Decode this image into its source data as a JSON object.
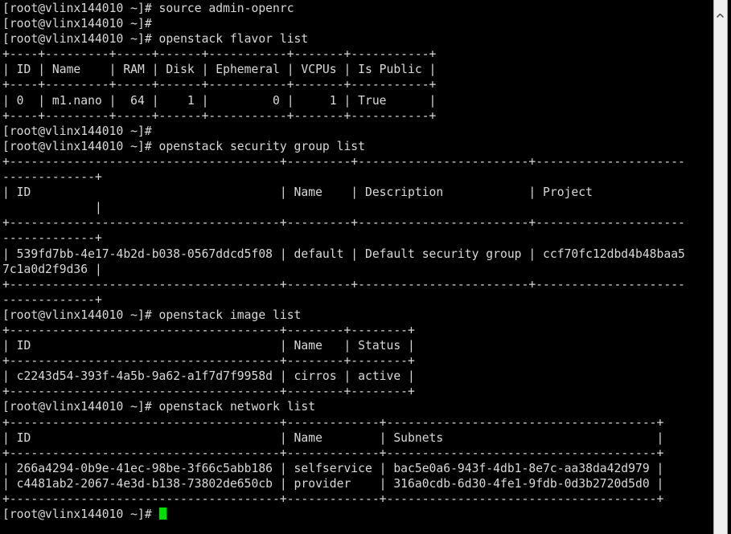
{
  "terminal": {
    "title": "root@vlinx144010:~",
    "prompt": "[root@vlinx144010 ~]#",
    "hostname": "vlinx144010",
    "user": "root",
    "cwd": "~",
    "colors": {
      "background": "#000000",
      "foreground": "#d8d8d8",
      "cursor": "#00e000",
      "scrollbar_track": "#f0f0f0"
    },
    "cursor": {
      "shape": "block",
      "visible": true
    },
    "lines": [
      "[root@vlinx144010 ~]# source admin-openrc",
      "[root@vlinx144010 ~]#",
      "[root@vlinx144010 ~]# openstack flavor list",
      "+----+---------+-----+------+-----------+-------+-----------+",
      "| ID | Name    | RAM | Disk | Ephemeral | VCPUs | Is Public |",
      "+----+---------+-----+------+-----------+-------+-----------+",
      "| 0  | m1.nano |  64 |    1 |         0 |     1 | True      |",
      "+----+---------+-----+------+-----------+-------+-----------+",
      "[root@vlinx144010 ~]#",
      "[root@vlinx144010 ~]# openstack security group list",
      "+--------------------------------------+---------+------------------------+----------------------------------+",
      "| ID                                   | Name    | Description            | Project                          |",
      "+--------------------------------------+---------+------------------------+----------------------------------+",
      "| 539fd7bb-4e17-4b2d-b038-0567ddcd5f08 | default | Default security group | ccf70fc12dbd4b48baa57c1a0d2f9d36 |",
      "+--------------------------------------+---------+------------------------+----------------------------------+",
      "[root@vlinx144010 ~]# openstack image list",
      "+--------------------------------------+--------+--------+",
      "| ID                                   | Name   | Status |",
      "+--------------------------------------+--------+--------+",
      "| c2243d54-393f-4a5b-9a62-a1f7d7f9958d | cirros | active |",
      "+--------------------------------------+--------+--------+",
      "[root@vlinx144010 ~]# openstack network list",
      "+--------------------------------------+-------------+--------------------------------------+",
      "| ID                                   | Name        | Subnets                              |",
      "+--------------------------------------+-------------+--------------------------------------+",
      "| 266a4294-0b9e-41ec-98be-3f66c5abb186 | selfservice | bac5e0a6-943f-4db1-8e7c-aa38da42d979 |",
      "| c4481ab2-2067-4e3d-b138-73802de650cb | provider    | 316a0cdb-6d30-4fe1-9fdb-0d3b2720d5d0 |",
      "+--------------------------------------+-------------+--------------------------------------+",
      "[root@vlinx144010 ~]#"
    ],
    "commands": [
      "source admin-openrc",
      "openstack flavor list",
      "openstack security group list",
      "openstack image list",
      "openstack network list"
    ],
    "tables": {
      "flavor_list": {
        "headers": [
          "ID",
          "Name",
          "RAM",
          "Disk",
          "Ephemeral",
          "VCPUs",
          "Is Public"
        ],
        "rows": [
          [
            "0",
            "m1.nano",
            "64",
            "1",
            "0",
            "1",
            "True"
          ]
        ]
      },
      "security_group_list": {
        "headers": [
          "ID",
          "Name",
          "Description",
          "Project"
        ],
        "rows": [
          [
            "539fd7bb-4e17-4b2d-b038-0567ddcd5f08",
            "default",
            "Default security group",
            "ccf70fc12dbd4b48baa57c1a0d2f9d36"
          ]
        ]
      },
      "image_list": {
        "headers": [
          "ID",
          "Name",
          "Status"
        ],
        "rows": [
          [
            "c2243d54-393f-4a5b-9a62-a1f7d7f9958d",
            "cirros",
            "active"
          ]
        ]
      },
      "network_list": {
        "headers": [
          "ID",
          "Name",
          "Subnets"
        ],
        "rows": [
          [
            "266a4294-0b9e-41ec-98be-3f66c5abb186",
            "selfservice",
            "bac5e0a6-943f-4db1-8e7c-aa38da42d979"
          ],
          [
            "c4481ab2-2067-4e3d-b138-73802de650cb",
            "provider",
            "316a0cdb-6d30-4fe1-9fdb-0d3b2720d5d0"
          ]
        ]
      }
    }
  },
  "scrollbar": {
    "up_arrow_icon": "chevron-up-icon",
    "thumb_position_percent": 0
  }
}
